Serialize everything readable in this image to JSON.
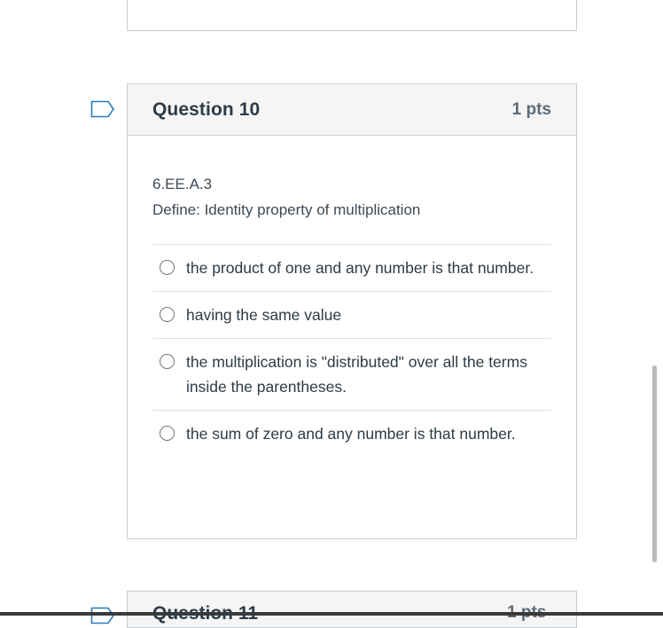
{
  "question10": {
    "title": "Question 10",
    "points": "1 pts",
    "standard": "6.EE.A.3",
    "prompt": "Define:  Identity property of multiplication",
    "answers": [
      {
        "label": "the product of one and any number is that number."
      },
      {
        "label": "having the same value"
      },
      {
        "label": "the multiplication is \"distributed\" over all the terms inside the parentheses."
      },
      {
        "label": "the sum of zero and any number is that number."
      }
    ]
  },
  "question11": {
    "title": "Question 11",
    "points": "1 pts"
  },
  "colors": {
    "flag": "#2b7abc",
    "header_bg": "#f5f5f5",
    "border": "#c7cdd1"
  }
}
